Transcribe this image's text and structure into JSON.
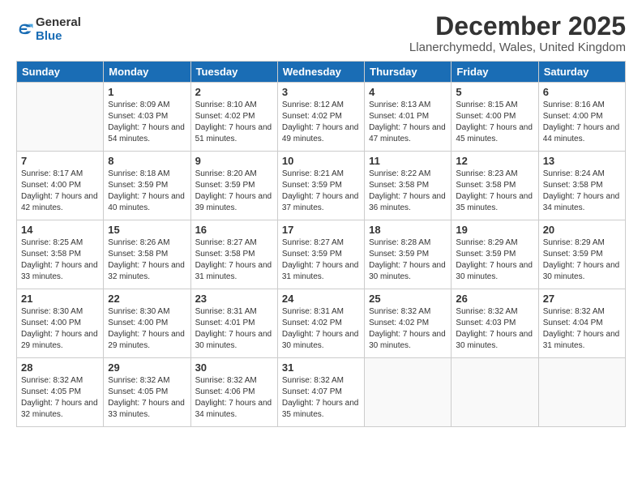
{
  "logo": {
    "general": "General",
    "blue": "Blue"
  },
  "title": "December 2025",
  "location": "Llanerchymedd, Wales, United Kingdom",
  "weekdays": [
    "Sunday",
    "Monday",
    "Tuesday",
    "Wednesday",
    "Thursday",
    "Friday",
    "Saturday"
  ],
  "weeks": [
    [
      {
        "day": "",
        "sunrise": "",
        "sunset": "",
        "daylight": ""
      },
      {
        "day": "1",
        "sunrise": "Sunrise: 8:09 AM",
        "sunset": "Sunset: 4:03 PM",
        "daylight": "Daylight: 7 hours and 54 minutes."
      },
      {
        "day": "2",
        "sunrise": "Sunrise: 8:10 AM",
        "sunset": "Sunset: 4:02 PM",
        "daylight": "Daylight: 7 hours and 51 minutes."
      },
      {
        "day": "3",
        "sunrise": "Sunrise: 8:12 AM",
        "sunset": "Sunset: 4:02 PM",
        "daylight": "Daylight: 7 hours and 49 minutes."
      },
      {
        "day": "4",
        "sunrise": "Sunrise: 8:13 AM",
        "sunset": "Sunset: 4:01 PM",
        "daylight": "Daylight: 7 hours and 47 minutes."
      },
      {
        "day": "5",
        "sunrise": "Sunrise: 8:15 AM",
        "sunset": "Sunset: 4:00 PM",
        "daylight": "Daylight: 7 hours and 45 minutes."
      },
      {
        "day": "6",
        "sunrise": "Sunrise: 8:16 AM",
        "sunset": "Sunset: 4:00 PM",
        "daylight": "Daylight: 7 hours and 44 minutes."
      }
    ],
    [
      {
        "day": "7",
        "sunrise": "Sunrise: 8:17 AM",
        "sunset": "Sunset: 4:00 PM",
        "daylight": "Daylight: 7 hours and 42 minutes."
      },
      {
        "day": "8",
        "sunrise": "Sunrise: 8:18 AM",
        "sunset": "Sunset: 3:59 PM",
        "daylight": "Daylight: 7 hours and 40 minutes."
      },
      {
        "day": "9",
        "sunrise": "Sunrise: 8:20 AM",
        "sunset": "Sunset: 3:59 PM",
        "daylight": "Daylight: 7 hours and 39 minutes."
      },
      {
        "day": "10",
        "sunrise": "Sunrise: 8:21 AM",
        "sunset": "Sunset: 3:59 PM",
        "daylight": "Daylight: 7 hours and 37 minutes."
      },
      {
        "day": "11",
        "sunrise": "Sunrise: 8:22 AM",
        "sunset": "Sunset: 3:58 PM",
        "daylight": "Daylight: 7 hours and 36 minutes."
      },
      {
        "day": "12",
        "sunrise": "Sunrise: 8:23 AM",
        "sunset": "Sunset: 3:58 PM",
        "daylight": "Daylight: 7 hours and 35 minutes."
      },
      {
        "day": "13",
        "sunrise": "Sunrise: 8:24 AM",
        "sunset": "Sunset: 3:58 PM",
        "daylight": "Daylight: 7 hours and 34 minutes."
      }
    ],
    [
      {
        "day": "14",
        "sunrise": "Sunrise: 8:25 AM",
        "sunset": "Sunset: 3:58 PM",
        "daylight": "Daylight: 7 hours and 33 minutes."
      },
      {
        "day": "15",
        "sunrise": "Sunrise: 8:26 AM",
        "sunset": "Sunset: 3:58 PM",
        "daylight": "Daylight: 7 hours and 32 minutes."
      },
      {
        "day": "16",
        "sunrise": "Sunrise: 8:27 AM",
        "sunset": "Sunset: 3:58 PM",
        "daylight": "Daylight: 7 hours and 31 minutes."
      },
      {
        "day": "17",
        "sunrise": "Sunrise: 8:27 AM",
        "sunset": "Sunset: 3:59 PM",
        "daylight": "Daylight: 7 hours and 31 minutes."
      },
      {
        "day": "18",
        "sunrise": "Sunrise: 8:28 AM",
        "sunset": "Sunset: 3:59 PM",
        "daylight": "Daylight: 7 hours and 30 minutes."
      },
      {
        "day": "19",
        "sunrise": "Sunrise: 8:29 AM",
        "sunset": "Sunset: 3:59 PM",
        "daylight": "Daylight: 7 hours and 30 minutes."
      },
      {
        "day": "20",
        "sunrise": "Sunrise: 8:29 AM",
        "sunset": "Sunset: 3:59 PM",
        "daylight": "Daylight: 7 hours and 30 minutes."
      }
    ],
    [
      {
        "day": "21",
        "sunrise": "Sunrise: 8:30 AM",
        "sunset": "Sunset: 4:00 PM",
        "daylight": "Daylight: 7 hours and 29 minutes."
      },
      {
        "day": "22",
        "sunrise": "Sunrise: 8:30 AM",
        "sunset": "Sunset: 4:00 PM",
        "daylight": "Daylight: 7 hours and 29 minutes."
      },
      {
        "day": "23",
        "sunrise": "Sunrise: 8:31 AM",
        "sunset": "Sunset: 4:01 PM",
        "daylight": "Daylight: 7 hours and 30 minutes."
      },
      {
        "day": "24",
        "sunrise": "Sunrise: 8:31 AM",
        "sunset": "Sunset: 4:02 PM",
        "daylight": "Daylight: 7 hours and 30 minutes."
      },
      {
        "day": "25",
        "sunrise": "Sunrise: 8:32 AM",
        "sunset": "Sunset: 4:02 PM",
        "daylight": "Daylight: 7 hours and 30 minutes."
      },
      {
        "day": "26",
        "sunrise": "Sunrise: 8:32 AM",
        "sunset": "Sunset: 4:03 PM",
        "daylight": "Daylight: 7 hours and 30 minutes."
      },
      {
        "day": "27",
        "sunrise": "Sunrise: 8:32 AM",
        "sunset": "Sunset: 4:04 PM",
        "daylight": "Daylight: 7 hours and 31 minutes."
      }
    ],
    [
      {
        "day": "28",
        "sunrise": "Sunrise: 8:32 AM",
        "sunset": "Sunset: 4:05 PM",
        "daylight": "Daylight: 7 hours and 32 minutes."
      },
      {
        "day": "29",
        "sunrise": "Sunrise: 8:32 AM",
        "sunset": "Sunset: 4:05 PM",
        "daylight": "Daylight: 7 hours and 33 minutes."
      },
      {
        "day": "30",
        "sunrise": "Sunrise: 8:32 AM",
        "sunset": "Sunset: 4:06 PM",
        "daylight": "Daylight: 7 hours and 34 minutes."
      },
      {
        "day": "31",
        "sunrise": "Sunrise: 8:32 AM",
        "sunset": "Sunset: 4:07 PM",
        "daylight": "Daylight: 7 hours and 35 minutes."
      },
      {
        "day": "",
        "sunrise": "",
        "sunset": "",
        "daylight": ""
      },
      {
        "day": "",
        "sunrise": "",
        "sunset": "",
        "daylight": ""
      },
      {
        "day": "",
        "sunrise": "",
        "sunset": "",
        "daylight": ""
      }
    ]
  ]
}
